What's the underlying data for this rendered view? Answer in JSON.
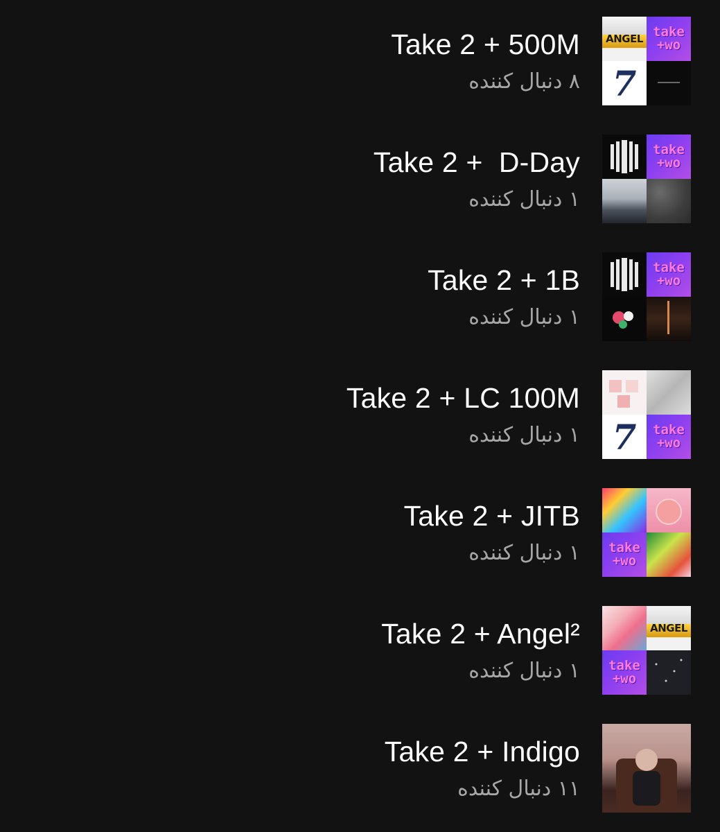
{
  "playlists": [
    {
      "title": "Take 2 + 500M",
      "followers": "۸ دنبال کننده",
      "cover_tiles": [
        "angel-cover",
        "take-two-cover",
        "seven-cover",
        "dark-cover"
      ]
    },
    {
      "title": "Take 2 +  D-Day",
      "followers": "۱ دنبال کننده",
      "cover_tiles": [
        "proof-cover",
        "take-two-cover",
        "landscape-cover",
        "texture-cover"
      ]
    },
    {
      "title": "Take 2 + 1B",
      "followers": "۱ دنبال کننده",
      "cover_tiles": [
        "proof-cover",
        "take-two-cover",
        "flower-cover",
        "sword-cover"
      ]
    },
    {
      "title": "Take 2 + LC 100M",
      "followers": "۱ دنبال کننده",
      "cover_tiles": [
        "pink-grid-cover",
        "silver-cover",
        "seven-cover",
        "take-two-cover"
      ]
    },
    {
      "title": "Take 2 + JITB",
      "followers": "۱ دنبال کننده",
      "cover_tiles": [
        "colorful-cover",
        "planet-cover",
        "take-two-cover",
        "green-art-cover"
      ]
    },
    {
      "title": "Take 2 + Angel²",
      "followers": "۱ دنبال کننده",
      "cover_tiles": [
        "floral-cover",
        "angel-cover",
        "take-two-cover",
        "dark-stars-cover"
      ]
    },
    {
      "title": "Take 2 + Indigo",
      "followers": "۱۱ دنبال کننده",
      "cover_tiles": [
        "portrait-cover"
      ]
    }
  ],
  "tile_text": {
    "seven": "7",
    "angel": "ANGEL",
    "take": "take",
    "two": "+wo"
  }
}
